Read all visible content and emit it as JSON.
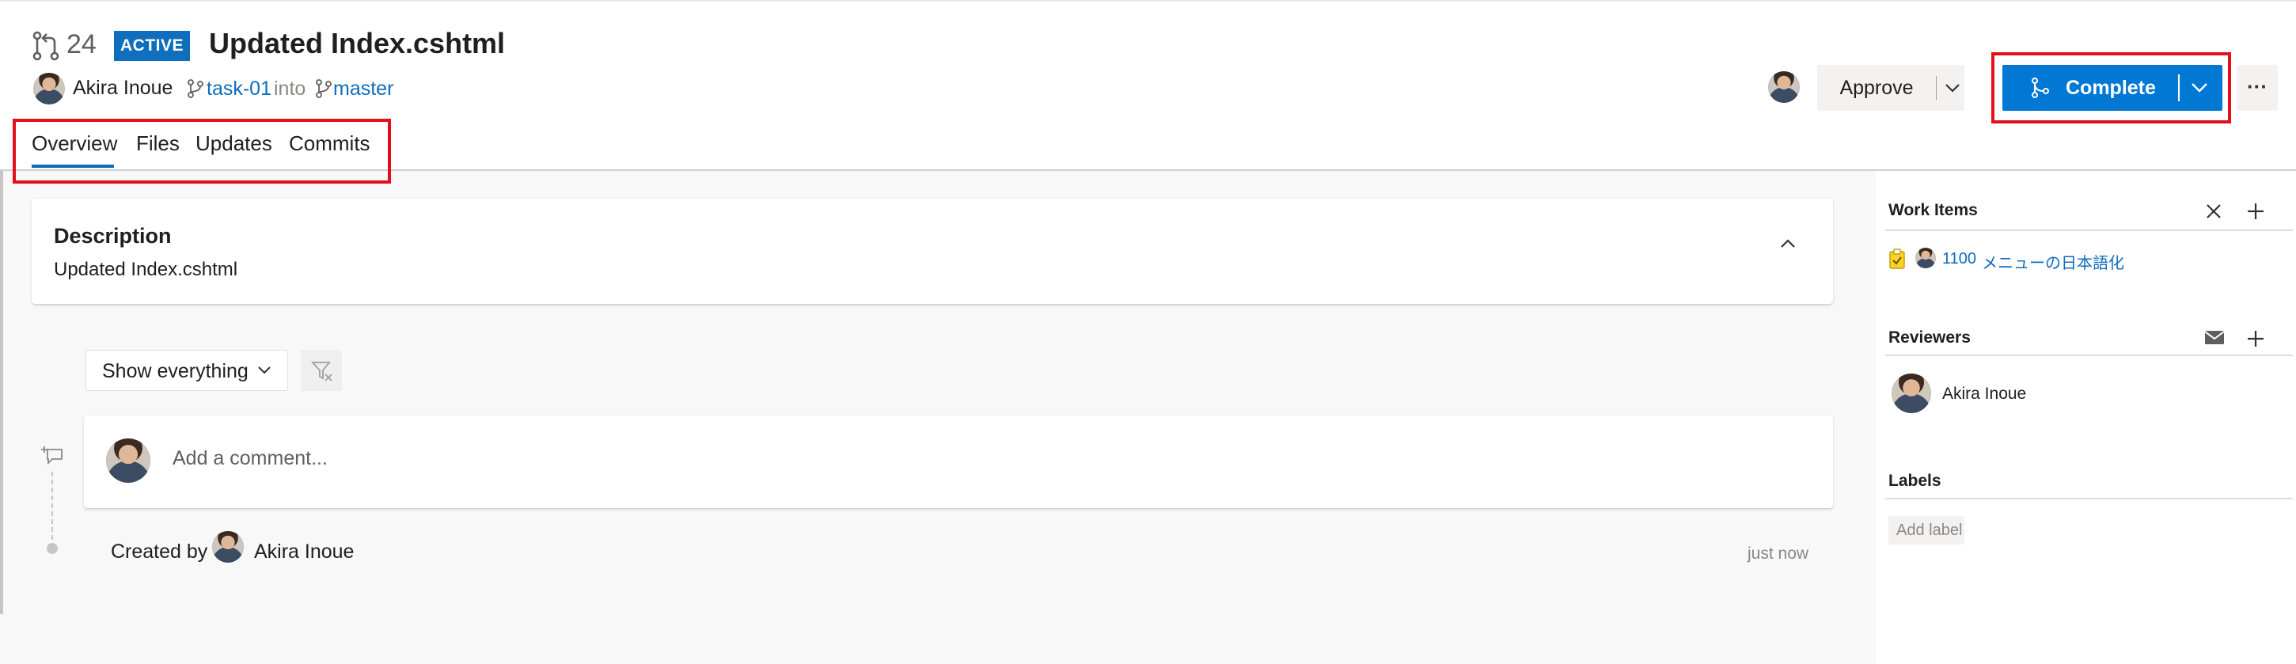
{
  "header": {
    "pr_number": "24",
    "status_badge": "ACTIVE",
    "title": "Updated Index.cshtml",
    "author": "Akira Inoue",
    "source_branch": "task-01",
    "into_text": "into",
    "target_branch": "master",
    "approve_label": "Approve",
    "complete_label": "Complete",
    "more_label": "···"
  },
  "tabs": [
    {
      "label": "Overview",
      "selected": true
    },
    {
      "label": "Files"
    },
    {
      "label": "Updates"
    },
    {
      "label": "Commits"
    }
  ],
  "description": {
    "title": "Description",
    "body": "Updated Index.cshtml"
  },
  "activity": {
    "filter_label": "Show everything",
    "comment_placeholder": "Add a comment...",
    "created_by_label": "Created by",
    "created_by_name": "Akira Inoue",
    "timestamp": "just now"
  },
  "sidebar": {
    "work_items_title": "Work Items",
    "work_item_id": "1100",
    "work_item_title": "メニューの日本語化",
    "reviewers_title": "Reviewers",
    "reviewer_name": "Akira Inoue",
    "labels_title": "Labels",
    "add_label": "Add label"
  },
  "colors": {
    "accent": "#0f6cbd",
    "primary_button": "#0078d4",
    "badge": "#106ebe",
    "highlight": "#e3101b",
    "page_gray": "#f8f8f8"
  }
}
